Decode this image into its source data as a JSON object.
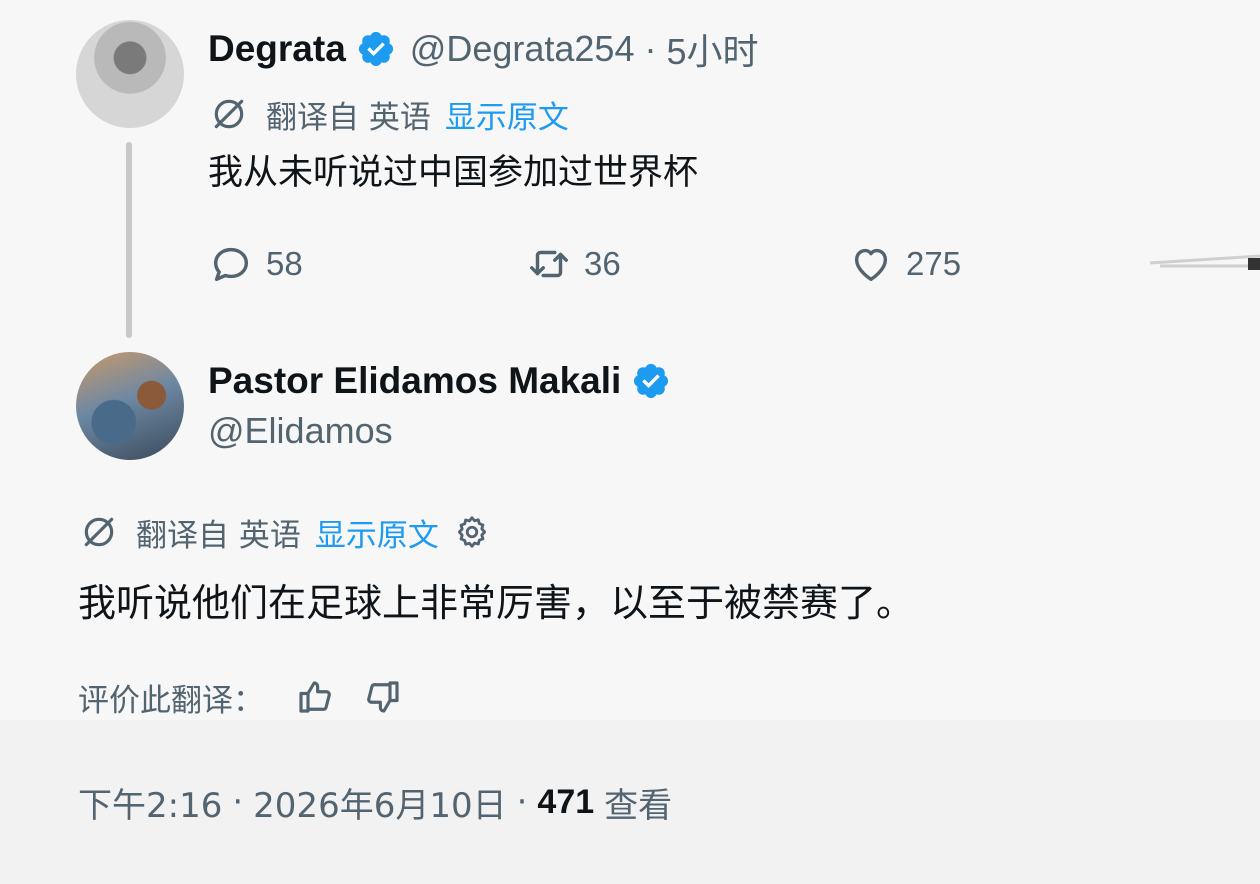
{
  "parent_tweet": {
    "display_name": "Degrata",
    "handle": "@Degrata254",
    "separator": "·",
    "time_ago": "5小时",
    "translated_from": "翻译自 英语",
    "show_original": "显示原文",
    "text": "我从未听说过中国参加过世界杯",
    "replies": "58",
    "retweets": "36",
    "likes": "275"
  },
  "reply_tweet": {
    "display_name": "Pastor Elidamos Makali",
    "handle": "@Elidamos",
    "translated_from": "翻译自 英语",
    "show_original": "显示原文",
    "text": "我听说他们在足球上非常厉害，以至于被禁赛了。",
    "rate_translation": "评价此翻译：",
    "time": "下午2:16",
    "date": "2026年6月10日",
    "separator": "·",
    "views_count": "471",
    "views_label": "查看"
  },
  "colors": {
    "verified": "#1d9bf0",
    "link": "#1d9bf0",
    "muted": "#536471",
    "text": "#0f1419"
  },
  "icons": [
    "verified-badge-icon",
    "translate-icon",
    "gear-icon",
    "reply-icon",
    "retweet-icon",
    "like-icon",
    "thumbs-up-icon",
    "thumbs-down-icon"
  ]
}
